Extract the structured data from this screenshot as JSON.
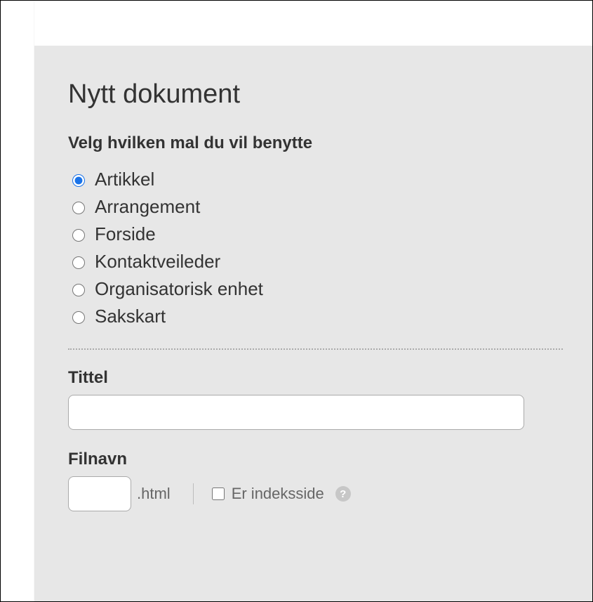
{
  "page": {
    "title": "Nytt dokument"
  },
  "template_section": {
    "label": "Velg hvilken mal du vil benytte",
    "options": [
      {
        "label": "Artikkel",
        "selected": true
      },
      {
        "label": "Arrangement",
        "selected": false
      },
      {
        "label": "Forside",
        "selected": false
      },
      {
        "label": "Kontaktveileder",
        "selected": false
      },
      {
        "label": "Organisatorisk enhet",
        "selected": false
      },
      {
        "label": "Sakskart",
        "selected": false
      }
    ]
  },
  "title_field": {
    "label": "Tittel",
    "value": ""
  },
  "filename_field": {
    "label": "Filnavn",
    "value": "",
    "extension": ".html"
  },
  "index_checkbox": {
    "label": "Er indeksside",
    "checked": false
  },
  "help_icon": {
    "glyph": "?"
  }
}
